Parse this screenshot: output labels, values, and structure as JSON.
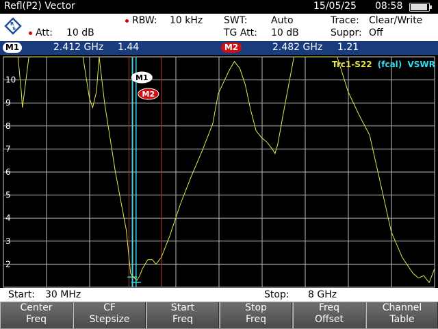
{
  "title": "Refl(P2) Vector",
  "date": "15/05/25",
  "time": "08:58",
  "settings": {
    "att_label": "Att:",
    "att_value": "10 dB",
    "rbw_label": "RBW:",
    "rbw_value": "10 kHz",
    "swt_label": "SWT:",
    "swt_value": "Auto",
    "tgatt_label": "TG Att:",
    "tgatt_value": "10 dB",
    "trace_label": "Trace:",
    "trace_value": "Clear/Write",
    "suppr_label": "Suppr:",
    "suppr_value": "Off"
  },
  "markers": [
    {
      "label": "M1",
      "freq": "2.412 GHz",
      "value": "1.44"
    },
    {
      "label": "M2",
      "freq": "2.482 GHz",
      "value": "1.21"
    }
  ],
  "trace_label": {
    "prefix": "Trc1-S22",
    "mid": "(fcal)",
    "suffix": "VSWR"
  },
  "colors": {
    "accent": "#1a3b7c",
    "trace": "#e8e84a",
    "marker_line": "#33ddee",
    "limit_line": "#c0392b",
    "m2_badge": "#cc1111"
  },
  "start_label": "Start:",
  "start_value": "30 MHz",
  "stop_label": "Stop:",
  "stop_value": "8 GHz",
  "softkeys": [
    {
      "line1": "Center",
      "line2": "Freq"
    },
    {
      "line1": "CF",
      "line2": "Stepsize"
    },
    {
      "line1": "Start",
      "line2": "Freq"
    },
    {
      "line1": "Stop",
      "line2": "Freq"
    },
    {
      "line1": "Freq",
      "line2": "Offset"
    },
    {
      "line1": "Channel",
      "line2": "Table"
    }
  ],
  "chart_data": {
    "type": "line",
    "x_start_ghz": 0.03,
    "x_stop_ghz": 8.0,
    "ylim": [
      1,
      11
    ],
    "yticks": [
      "10",
      "9",
      "8",
      "7",
      "6",
      "5",
      "4",
      "3",
      "2"
    ],
    "grid": true,
    "series": [
      {
        "x_ghz": [
          0.03,
          0.3,
          0.36,
          0.38,
          0.42,
          0.5,
          1.5,
          1.62,
          1.68,
          1.75,
          1.8,
          1.9,
          2.1,
          2.3,
          2.38,
          2.41,
          2.45,
          2.5,
          2.55,
          2.6,
          2.7,
          2.78,
          2.85,
          2.95,
          3.1,
          3.3,
          3.5,
          3.7,
          3.9,
          4.0,
          4.2,
          4.3,
          4.4,
          4.5,
          4.6,
          4.7,
          4.8,
          4.9,
          5.0,
          5.05,
          5.1,
          5.2,
          5.4,
          5.6,
          5.8,
          6.0,
          6.2,
          6.4,
          6.6,
          6.8,
          7.0,
          7.2,
          7.4,
          7.6,
          7.7,
          7.8,
          7.9,
          8.0
        ],
        "values": [
          11,
          11,
          9.5,
          8.8,
          9.5,
          11,
          11,
          9.2,
          8.8,
          9.5,
          11,
          9,
          6,
          3.5,
          1.6,
          1.5,
          1.4,
          1.3,
          1.5,
          1.8,
          2.2,
          2.2,
          2,
          2.3,
          3.2,
          4.6,
          5.8,
          6.9,
          8.1,
          9.4,
          10.4,
          10.8,
          10.5,
          9.8,
          8.7,
          7.8,
          7.5,
          7.3,
          7.0,
          6.8,
          7.2,
          8.5,
          11,
          11,
          11,
          11,
          11,
          9.5,
          8.5,
          7.6,
          5.5,
          3.4,
          2.3,
          1.6,
          1.4,
          1.5,
          1.2,
          1.8
        ]
      }
    ],
    "markers": [
      {
        "name": "M1",
        "x_ghz": 2.412,
        "value": 1.44
      },
      {
        "name": "M2",
        "x_ghz": 2.482,
        "value": 1.21
      }
    ],
    "limit_lines_ghz": [
      2.35,
      2.95
    ]
  }
}
